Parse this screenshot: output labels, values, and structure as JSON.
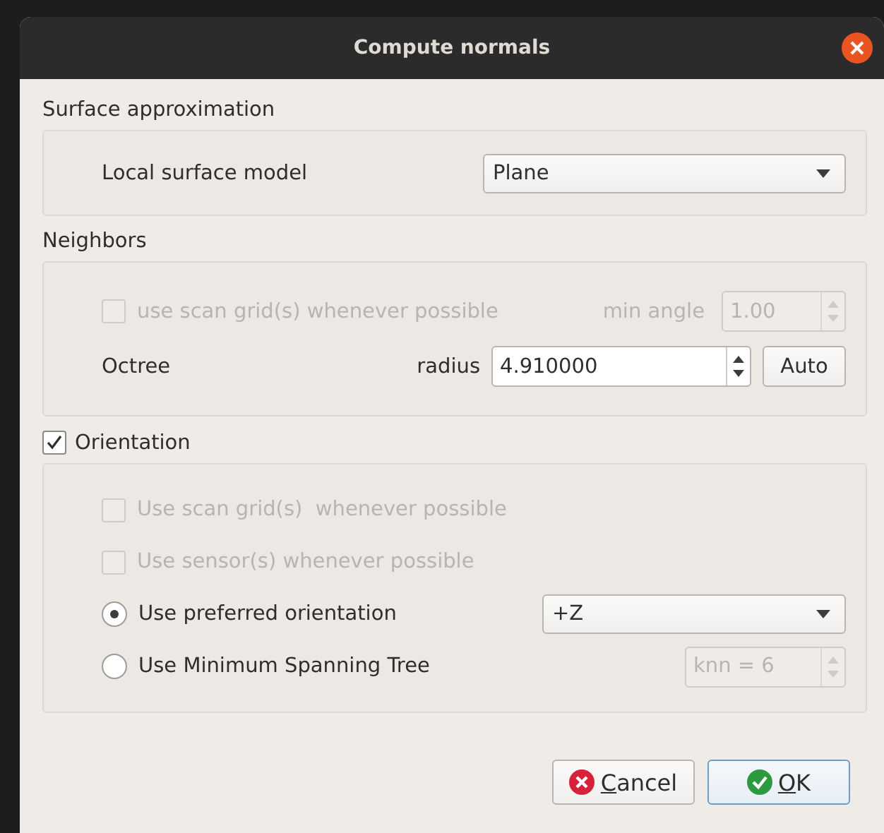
{
  "window": {
    "title": "Compute normals"
  },
  "surface": {
    "title": "Surface approximation",
    "label": "Local surface model",
    "model": "Plane"
  },
  "neighbors": {
    "title": "Neighbors",
    "scan_grid": {
      "label": "use scan grid(s) whenever possible",
      "checked": false,
      "disabled": true
    },
    "min_angle": {
      "label": "min angle",
      "value": "1.00",
      "disabled": true
    },
    "octree_label": "Octree",
    "radius_label": "radius",
    "radius": "4.910000",
    "auto_button": "Auto"
  },
  "orientation": {
    "label": "Orientation",
    "checked": true,
    "options": [
      {
        "kind": "checkbox",
        "label": "Use scan grid(s)  whenever possible",
        "checked": false,
        "disabled": true
      },
      {
        "kind": "checkbox",
        "label": "Use sensor(s) whenever possible",
        "checked": false,
        "disabled": true
      },
      {
        "kind": "radio",
        "label": "Use preferred orientation",
        "selected": true,
        "combo": "+Z"
      },
      {
        "kind": "radio",
        "label": "Use Minimum Spanning Tree",
        "selected": false,
        "spin": "knn = 6",
        "spin_disabled": true
      }
    ]
  },
  "buttons": [
    {
      "kind": "cancel",
      "label": "Cancel",
      "default": false
    },
    {
      "kind": "ok",
      "label": "OK",
      "default": true
    }
  ]
}
